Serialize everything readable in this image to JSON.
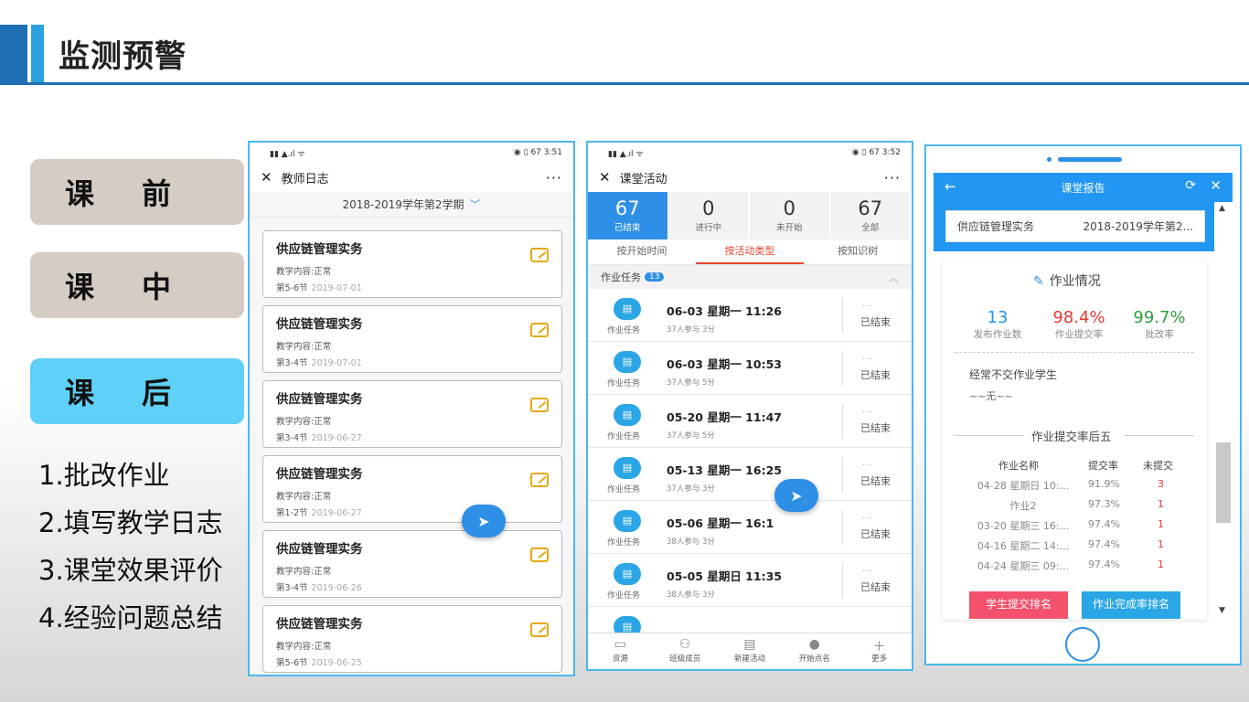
{
  "slide": {
    "title": "监测预警"
  },
  "phases": [
    {
      "label": "课前",
      "active": false
    },
    {
      "label": "课中",
      "active": false
    },
    {
      "label": "课后",
      "active": true
    }
  ],
  "steps": [
    "1.批改作业",
    "2.填写教学日志",
    "3.课堂效果评价",
    "4.经验问题总结"
  ],
  "phone1": {
    "time": "3:51",
    "battery": "67",
    "title": "教师日志",
    "more": "···",
    "semester": "2018-2019学年第2学期",
    "cards": [
      {
        "title": "供应链管理实务",
        "content": "教学内容:正常",
        "section": "第5-6节",
        "date": "2019-07-01"
      },
      {
        "title": "供应链管理实务",
        "content": "教学内容:正常",
        "section": "第3-4节",
        "date": "2019-07-01"
      },
      {
        "title": "供应链管理实务",
        "content": "教学内容:正常",
        "section": "第3-4节",
        "date": "2019-06-27"
      },
      {
        "title": "供应链管理实务",
        "content": "教学内容:正常",
        "section": "第1-2节",
        "date": "2019-06-27"
      },
      {
        "title": "供应链管理实务",
        "content": "教学内容:正常",
        "section": "第3-4节",
        "date": "2019-06-26"
      },
      {
        "title": "供应链管理实务",
        "content": "教学内容:正常",
        "section": "第5-6节",
        "date": "2019-06-25"
      }
    ]
  },
  "phone2": {
    "time": "3:52",
    "battery": "67",
    "title": "课堂活动",
    "more": "···",
    "stats": [
      {
        "num": "67",
        "label": "已结束"
      },
      {
        "num": "0",
        "label": "进行中"
      },
      {
        "num": "0",
        "label": "未开始"
      },
      {
        "num": "67",
        "label": "全部"
      }
    ],
    "tabs": [
      "按开始时间",
      "按活动类型",
      "按知识树"
    ],
    "section": {
      "label": "作业任务",
      "count": "13"
    },
    "rows": [
      {
        "icon_label": "作业任务",
        "time": "06-03 星期一 11:26",
        "sub": "37人参与  3分",
        "status": "已结束"
      },
      {
        "icon_label": "作业任务",
        "time": "06-03 星期一 10:53",
        "sub": "37人参与  5分",
        "status": "已结束"
      },
      {
        "icon_label": "作业任务",
        "time": "05-20 星期一 11:47",
        "sub": "37人参与  5分",
        "status": "已结束"
      },
      {
        "icon_label": "作业任务",
        "time": "05-13 星期一 16:25",
        "sub": "37人参与  3分",
        "status": "已结束"
      },
      {
        "icon_label": "作业任务",
        "time": "05-06 星期一 16:1",
        "sub": "38人参与  3分",
        "status": "已结束"
      },
      {
        "icon_label": "作业任务",
        "time": "05-05 星期日 11:35",
        "sub": "38人参与  3分",
        "status": "已结束"
      }
    ],
    "nav": [
      "资源",
      "班级成员",
      "新建活动",
      "开始点名",
      "更多"
    ]
  },
  "phone3": {
    "header": "课堂报告",
    "course": "供应链管理实务",
    "term": "2018-2019学年第2...",
    "section_title": "作业情况",
    "kpis": [
      {
        "value": "13",
        "label": "发布作业数",
        "color": "#2196f3"
      },
      {
        "value": "98.4%",
        "label": "作业提交率",
        "color": "#e53935"
      },
      {
        "value": "99.7%",
        "label": "批改率",
        "color": "#2e9e3e"
      }
    ],
    "no_submit_title": "经常不交作业学生",
    "no_submit_value": "~~无~~",
    "rank_title": "作业提交率后五",
    "table_headers": [
      "作业名称",
      "提交率",
      "未提交"
    ],
    "table_rows": [
      [
        "04-28 星期日 10:...",
        "91.9%",
        "3"
      ],
      [
        "作业2",
        "97.3%",
        "1"
      ],
      [
        "03-20 星期三 16:...",
        "97.4%",
        "1"
      ],
      [
        "04-16 星期二 14:...",
        "97.4%",
        "1"
      ],
      [
        "04-24 星期三 09:...",
        "97.4%",
        "1"
      ]
    ],
    "btn_left": "学生提交排名",
    "btn_right": "作业完成率排名"
  }
}
